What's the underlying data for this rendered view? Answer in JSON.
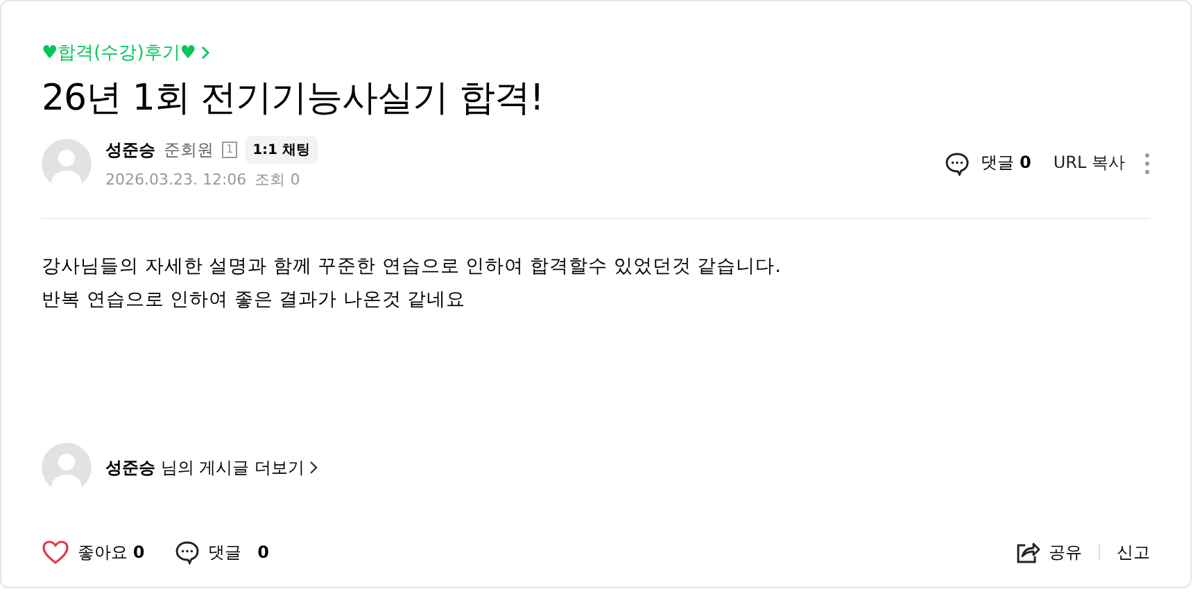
{
  "category": "♥합격(수강)후기♥",
  "title": "26년 1회 전기기능사실기 합격!",
  "author": {
    "name": "성준승",
    "grade": "준회원",
    "level_badge": "1",
    "chat_button": "1:1 채팅",
    "date": "2026.03.23. 12:06",
    "views_label": "조회",
    "views": "0"
  },
  "header_actions": {
    "comment_label": "댓글",
    "comment_count": "0",
    "url_copy": "URL 복사"
  },
  "body": [
    "강사님들의 자세한 설명과 함께 꾸준한 연습으로 인하여 합격할수 있었던것 같습니다.",
    "반복 연습으로 인하여 좋은 결과가 나온것 같네요"
  ],
  "more_posts": {
    "name": "성준승",
    "suffix": "님의 게시글 더보기"
  },
  "footer": {
    "like_label": "좋아요",
    "like_count": "0",
    "liked": false,
    "comment_label": "댓글",
    "comment_count": "0",
    "share": "공유",
    "report": "신고"
  }
}
